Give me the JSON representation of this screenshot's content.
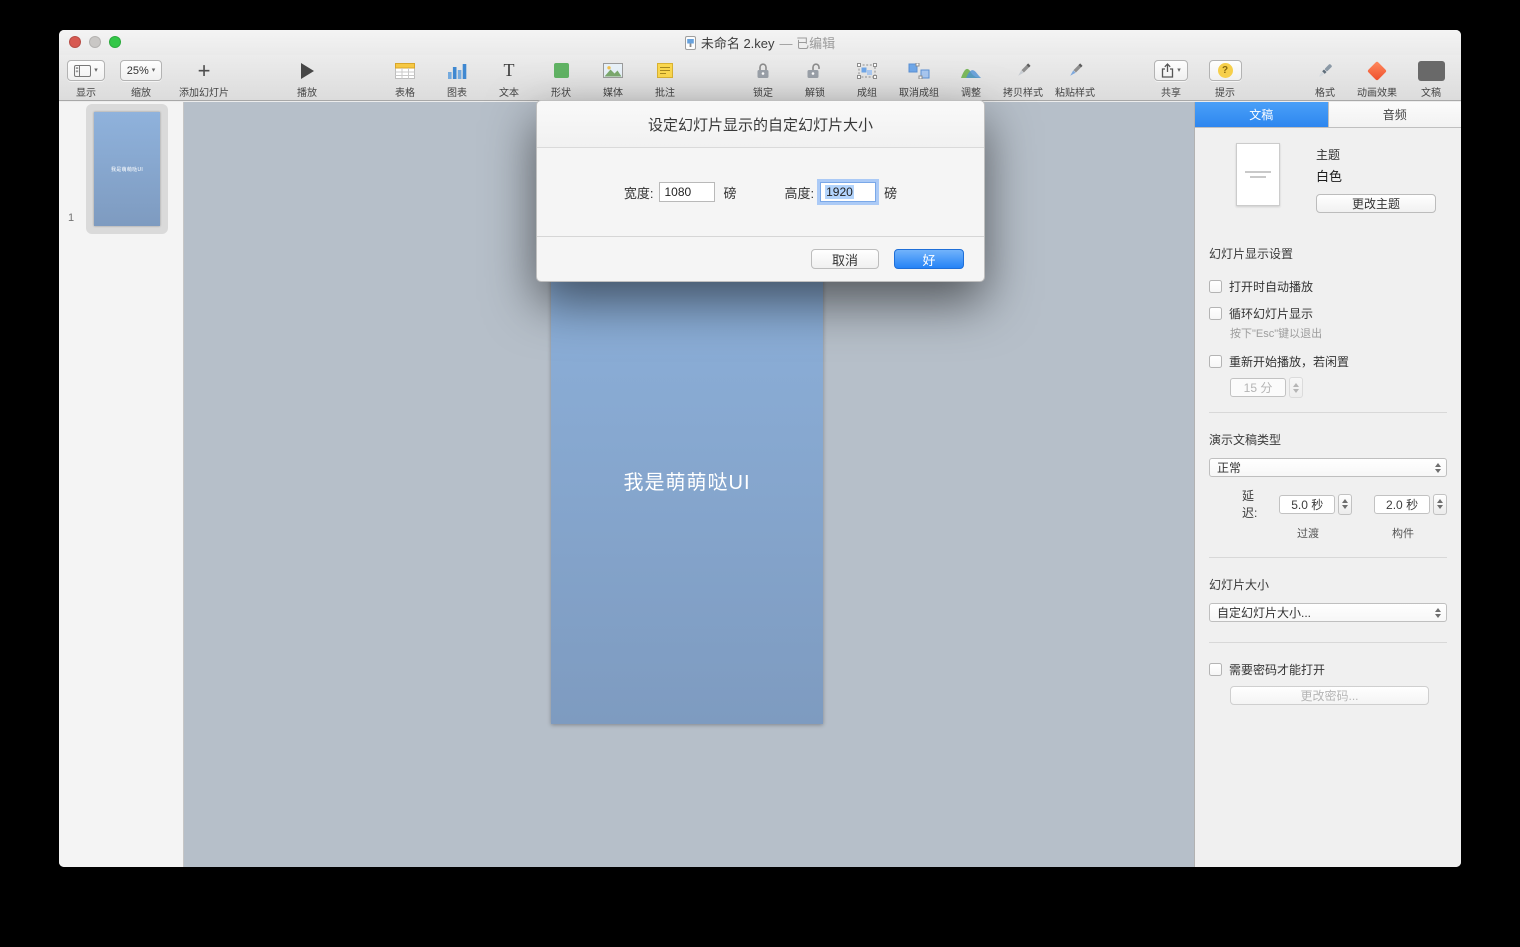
{
  "titlebar": {
    "title_doc": "未命名 2.key",
    "title_status": "— 已编辑"
  },
  "toolbar": {
    "items": [
      {
        "label": "显示"
      },
      {
        "label": "缩放",
        "value": "25%"
      },
      {
        "label": "添加幻灯片"
      },
      {
        "label": "播放"
      },
      {
        "label": "表格"
      },
      {
        "label": "图表"
      },
      {
        "label": "文本"
      },
      {
        "label": "形状"
      },
      {
        "label": "媒体"
      },
      {
        "label": "批注"
      },
      {
        "label": "锁定"
      },
      {
        "label": "解锁"
      },
      {
        "label": "成组"
      },
      {
        "label": "取消成组"
      },
      {
        "label": "调整"
      },
      {
        "label": "拷贝样式"
      },
      {
        "label": "粘贴样式"
      },
      {
        "label": "共享"
      },
      {
        "label": "提示"
      },
      {
        "label": "格式"
      },
      {
        "label": "动画效果"
      },
      {
        "label": "文稿"
      }
    ]
  },
  "sidebar": {
    "slide_number": "1",
    "thumb_text": "我是萌萌哒UI"
  },
  "slide": {
    "text": "我是萌萌哒UI"
  },
  "dialog": {
    "title": "设定幻灯片显示的自定幻灯片大小",
    "width_label": "宽度:",
    "width_value": "1080",
    "width_unit": "磅",
    "height_label": "高度:",
    "height_value": "1920",
    "height_unit": "磅",
    "cancel": "取消",
    "ok": "好"
  },
  "inspector": {
    "tabs": [
      {
        "label": "文稿"
      },
      {
        "label": "音频"
      }
    ],
    "theme": {
      "label": "主题",
      "name": "白色",
      "change_button": "更改主题"
    },
    "slideshow": {
      "title": "幻灯片显示设置",
      "autoplay": "打开时自动播放",
      "loop": "循环幻灯片显示",
      "loop_hint": "按下\"Esc\"键以退出",
      "restart": "重新开始播放，若闲置",
      "restart_value": "15 分"
    },
    "presentation": {
      "title": "演示文稿类型",
      "type_value": "正常",
      "delay_label": "延迟:",
      "transition_value": "5.0 秒",
      "transition_label": "过渡",
      "build_value": "2.0 秒",
      "build_label": "构件"
    },
    "slide_size": {
      "title": "幻灯片大小",
      "value": "自定幻灯片大小..."
    },
    "password": {
      "label": "需要密码才能打开",
      "change_button": "更改密码..."
    }
  }
}
